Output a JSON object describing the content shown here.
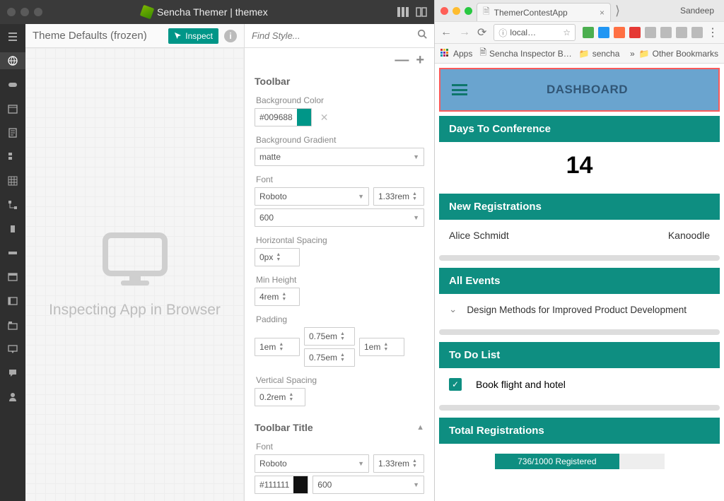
{
  "themer": {
    "titlebar": {
      "app_name": "Sencha Themer",
      "separator": " | ",
      "project": "themex"
    },
    "mid_header": {
      "title": "Theme Defaults (frozen)",
      "inspect_label": "Inspect"
    },
    "canvas_text": "Inspecting App in Browser",
    "search_placeholder": "Find Style...",
    "collapse_label": "—",
    "expand_label": "+",
    "sections": {
      "toolbar": {
        "title": "Toolbar",
        "bg_color": {
          "label": "Background Color",
          "value": "#009688"
        },
        "bg_gradient": {
          "label": "Background Gradient",
          "value": "matte"
        },
        "font": {
          "label": "Font",
          "family": "Roboto",
          "size": "1.33rem",
          "weight": "600"
        },
        "h_spacing": {
          "label": "Horizontal Spacing",
          "value": "0px"
        },
        "min_height": {
          "label": "Min Height",
          "value": "4rem"
        },
        "padding": {
          "label": "Padding",
          "left": "1em",
          "top": "0.75em",
          "bottom": "0.75em",
          "right": "1em"
        },
        "v_spacing": {
          "label": "Vertical Spacing",
          "value": "0.2rem"
        }
      },
      "toolbar_title": {
        "title": "Toolbar Title",
        "font": {
          "label": "Font",
          "family": "Roboto",
          "size": "1.33rem",
          "color": "#111111",
          "weight": "600"
        }
      }
    }
  },
  "browser": {
    "tab_title": "ThemerContestApp",
    "user": "Sandeep",
    "address": "local…",
    "bookmarks": {
      "apps": "Apps",
      "inspector": "Sencha Inspector B…",
      "folder": "sencha",
      "other": "Other Bookmarks"
    },
    "page": {
      "dashboard_title": "DASHBOARD",
      "days": {
        "head": "Days To Conference",
        "value": "14"
      },
      "new_reg": {
        "head": "New Registrations",
        "name": "Alice Schmidt",
        "company": "Kanoodle"
      },
      "events": {
        "head": "All Events",
        "item": "Design Methods for Improved Product Development"
      },
      "todo": {
        "head": "To Do List",
        "item": "Book flight and hotel"
      },
      "total": {
        "head": "Total Registrations",
        "progress_label": "736/1000 Registered"
      }
    }
  }
}
